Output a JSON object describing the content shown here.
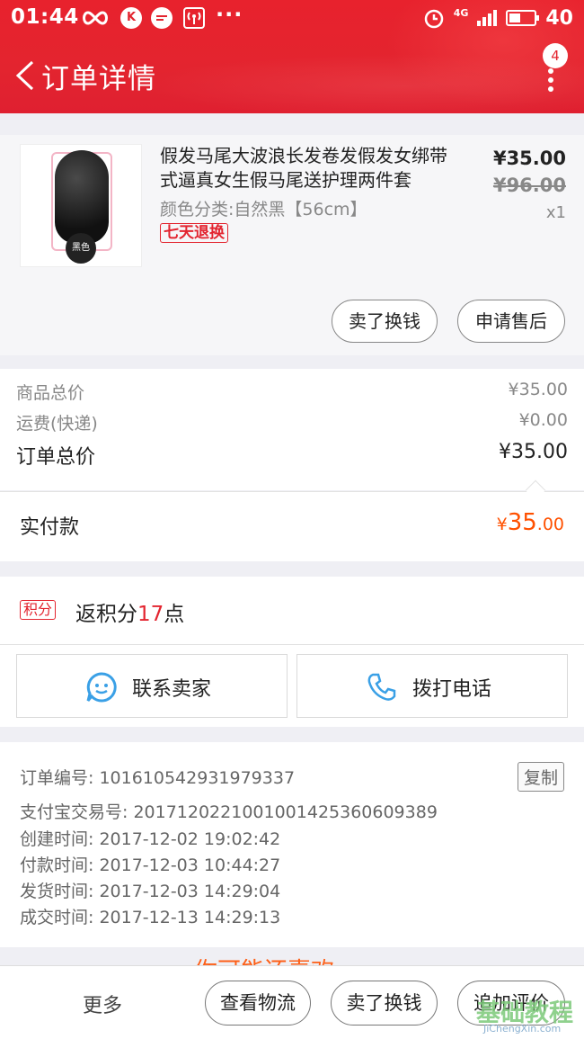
{
  "status_bar": {
    "time": "01:44",
    "app_icon_1": "K",
    "dots": "···",
    "network": "4G",
    "battery": "40"
  },
  "nav": {
    "title": "订单详情",
    "badge": "4"
  },
  "product": {
    "title": "假发马尾大波浪长发卷发假发女绑带式逼真女生假马尾送护理两件套",
    "sku": "颜色分类:自然黑【56cm】",
    "tag": "七天退换",
    "price": "¥35.00",
    "original_price": "¥96.00",
    "quantity": "x1",
    "thumb_label": "黑色",
    "buttons": [
      "卖了换钱",
      "申请售后"
    ]
  },
  "fees": {
    "goods_label": "商品总价",
    "goods_value": "¥35.00",
    "shipping_label": "运费(快递)",
    "shipping_value": "¥0.00",
    "total_label": "订单总价",
    "total_value": "¥35.00"
  },
  "payment": {
    "label": "实付款",
    "currency": "¥",
    "integer": "35",
    "decimal": ".00"
  },
  "points": {
    "tag": "积分",
    "prefix": "返积分",
    "number": "17",
    "suffix": "点"
  },
  "contact": {
    "seller": "联系卖家",
    "phone": "拨打电话"
  },
  "order_info": {
    "order_no": "订单编号: 101610542931979337",
    "alipay_no": "支付宝交易号: 2017120221001001425360609389",
    "created": "创建时间: 2017-12-02 19:02:42",
    "paid": "付款时间: 2017-12-03 10:44:27",
    "shipped": "发货时间: 2017-12-03 14:29:04",
    "completed": "成交时间: 2017-12-13 14:29:13",
    "copy": "复制"
  },
  "peek": {
    "text": "你可能还喜欢"
  },
  "bottom_bar": {
    "more": "更多",
    "logistics": "查看物流",
    "sell": "卖了换钱",
    "review": "追加评价"
  },
  "watermark": {
    "main": "基础教程",
    "sub": "JiChengXin.com"
  },
  "colors": {
    "brand_red": "#e3242f",
    "price_orange": "#ff5000",
    "link_blue": "#3aa0e6"
  }
}
